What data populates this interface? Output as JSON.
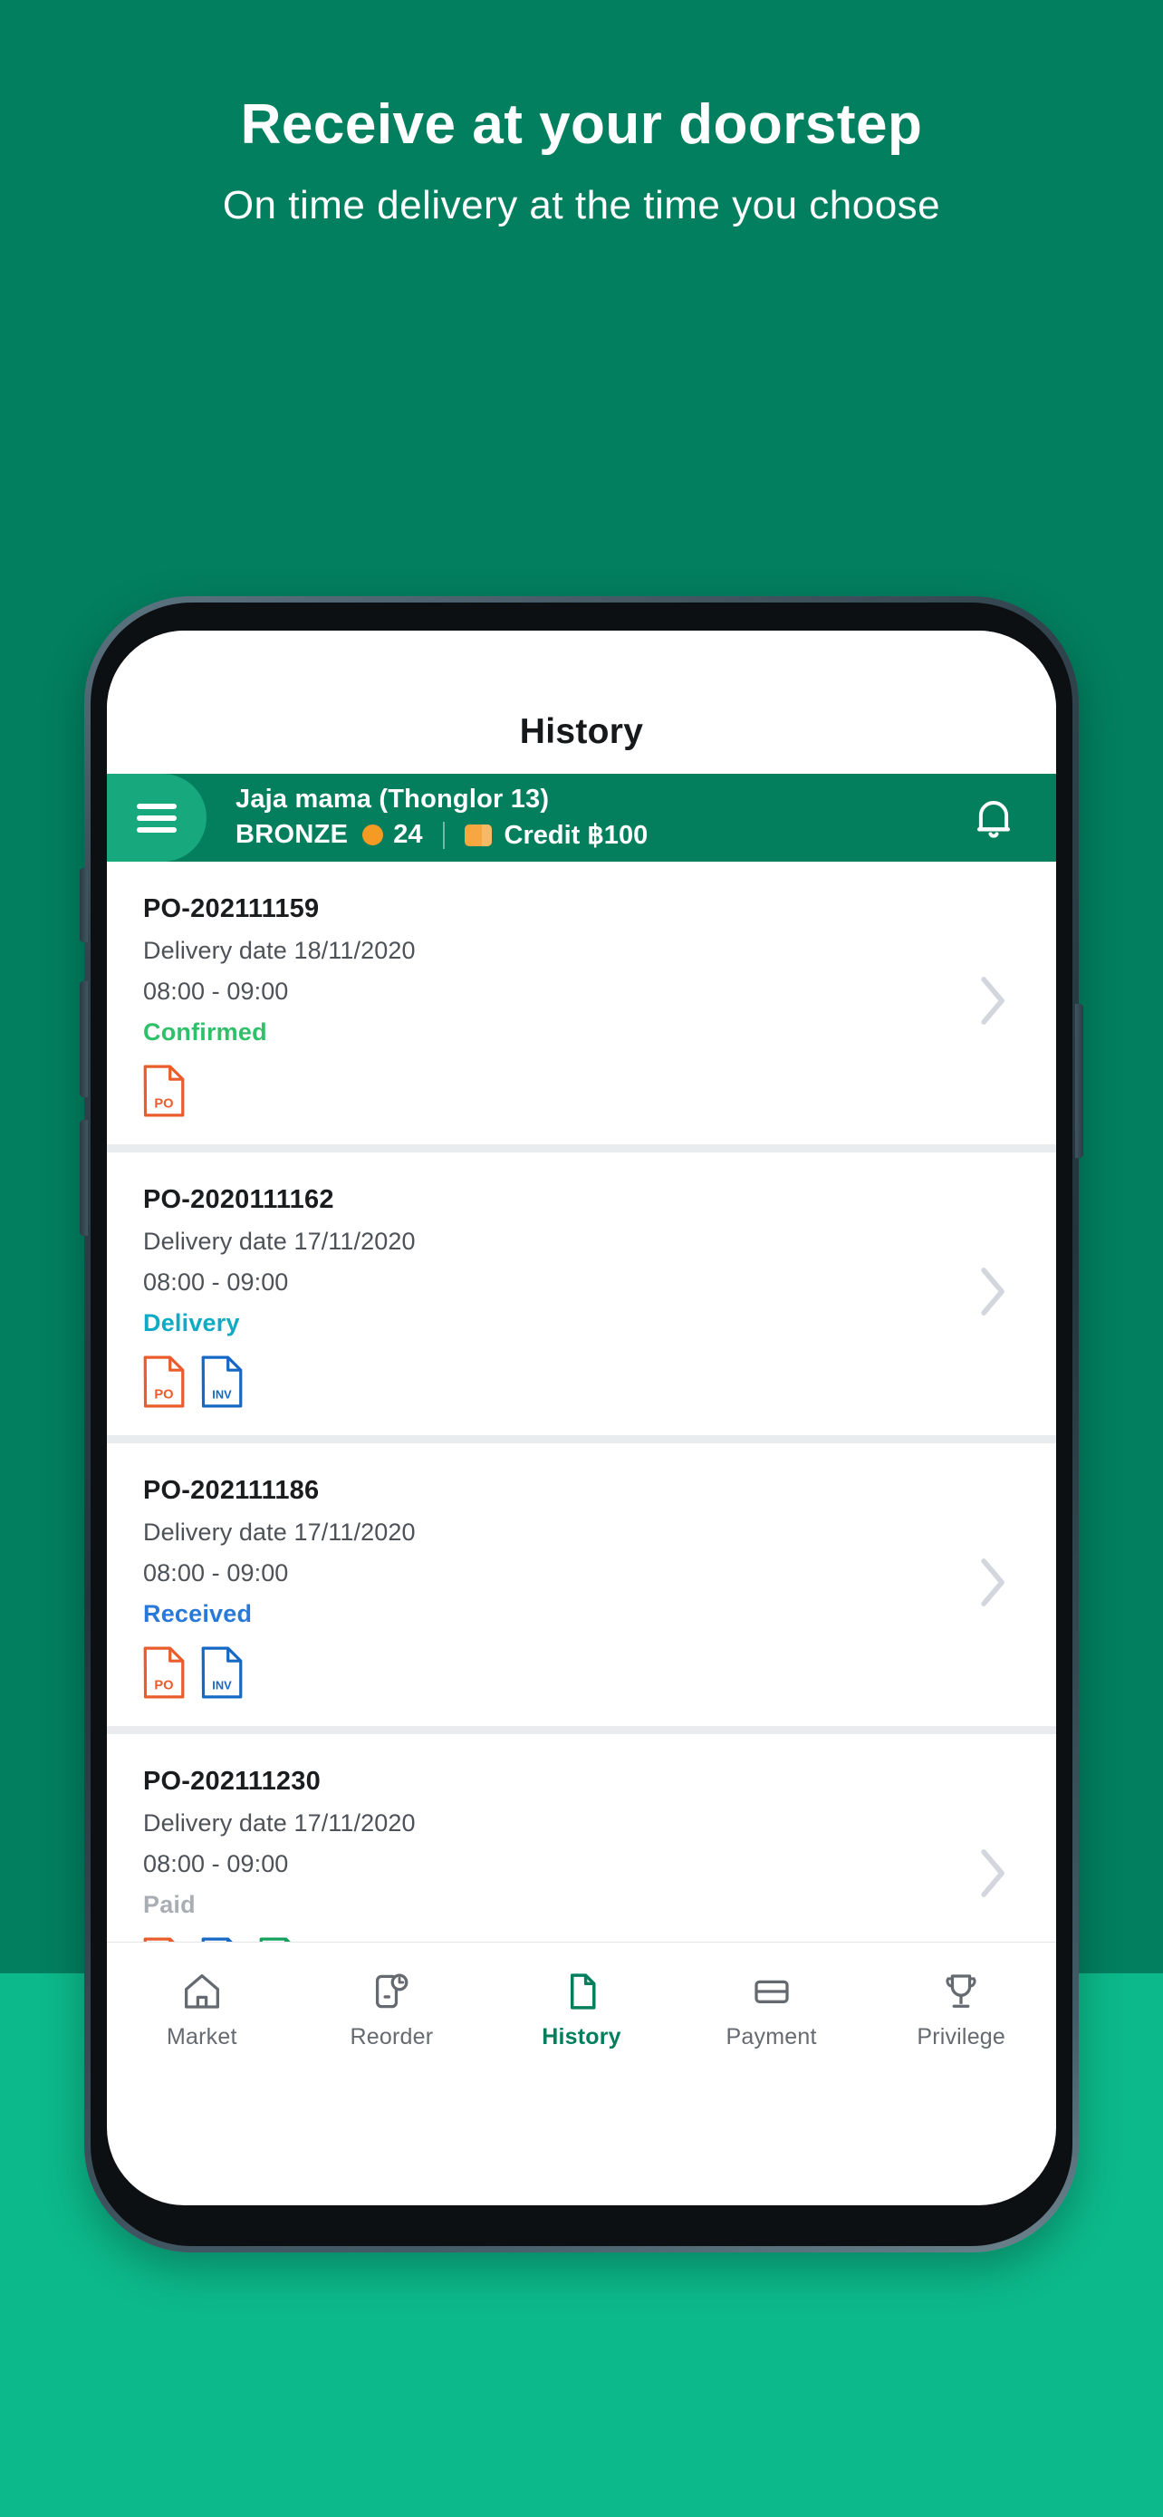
{
  "promo": {
    "headline": "Receive at your doorstep",
    "subheadline": "On time delivery at the time you choose",
    "bg_top_color": "#027f5f",
    "bg_bottom_color": "#0cb98a"
  },
  "app": {
    "title": "History",
    "account": {
      "name": "Jaja mama (Thonglor 13)",
      "tier": "BRONZE",
      "points": "24",
      "credit": "Credit ฿100",
      "menu_icon": "hamburger-menu-icon",
      "coin_icon": "coin-icon",
      "card_icon": "credit-card-icon",
      "bell_icon": "notification-bell-icon",
      "bar_color": "#047f5d",
      "menu_button_color": "#17a97d",
      "coin_color": "#f59a23",
      "card_color": "#f7a741"
    },
    "orders": [
      {
        "id": "PO-202111159",
        "delivery_date": "Delivery date 18/11/2020",
        "time_slot": "08:00 - 09:00",
        "status": "Confirmed",
        "status_color": "#2fc06a",
        "docs": [
          {
            "label": "PO",
            "color": "#ea5c2b"
          }
        ],
        "chevron_icon": "chevron-right-icon"
      },
      {
        "id": "PO-2020111162",
        "delivery_date": "Delivery date 17/11/2020",
        "time_slot": "08:00 - 09:00",
        "status": "Delivery",
        "status_color": "#0faac4",
        "docs": [
          {
            "label": "PO",
            "color": "#ea5c2b"
          },
          {
            "label": "INV",
            "color": "#1668c5"
          }
        ],
        "chevron_icon": "chevron-right-icon"
      },
      {
        "id": "PO-202111186",
        "delivery_date": "Delivery date 17/11/2020",
        "time_slot": "08:00 - 09:00",
        "status": "Received",
        "status_color": "#2979d8",
        "docs": [
          {
            "label": "PO",
            "color": "#ea5c2b"
          },
          {
            "label": "INV",
            "color": "#1668c5"
          }
        ],
        "chevron_icon": "chevron-right-icon"
      },
      {
        "id": "PO-202111230",
        "delivery_date": "Delivery date 17/11/2020",
        "time_slot": "08:00 - 09:00",
        "status": "Paid",
        "status_color": "#a9aeb5",
        "docs": [
          {
            "label": "PO",
            "color": "#ea5c2b"
          },
          {
            "label": "INV",
            "color": "#1668c5"
          },
          {
            "label": "REC",
            "color": "#12a05c"
          }
        ],
        "chevron_icon": "chevron-right-icon"
      }
    ],
    "bottom_nav": {
      "active_color": "#047f5d",
      "inactive_color": "#656a70",
      "items": [
        {
          "label": "Market",
          "icon": "home-icon",
          "active": false
        },
        {
          "label": "Reorder",
          "icon": "reorder-clock-icon",
          "active": false
        },
        {
          "label": "History",
          "icon": "document-icon",
          "active": true
        },
        {
          "label": "Payment",
          "icon": "card-icon",
          "active": false
        },
        {
          "label": "Privilege",
          "icon": "trophy-icon",
          "active": false
        }
      ]
    }
  }
}
